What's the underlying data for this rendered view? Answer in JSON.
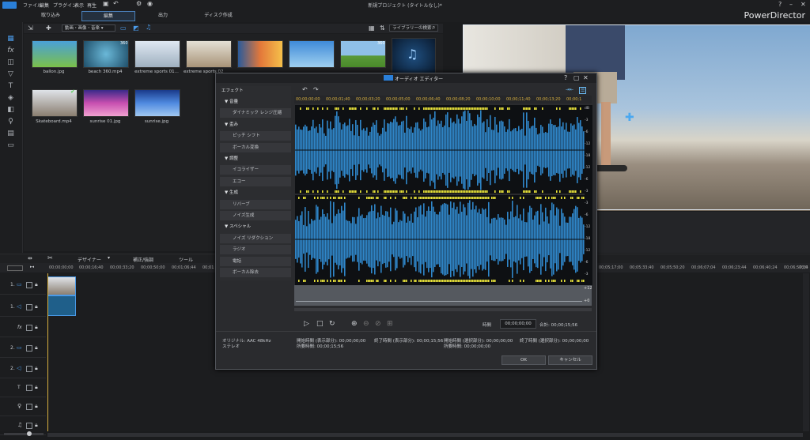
{
  "menu": [
    "ファイル",
    "編集",
    "プラグイン",
    "表示",
    "再生"
  ],
  "doc_title": "新規プロジェクト (タイトルなし)*",
  "brand": "PowerDirector",
  "modes": {
    "capture": "取り込み",
    "edit": "編集",
    "output": "出力",
    "disc": "ディスク作成"
  },
  "library": {
    "filter": "動画・画像・音楽",
    "search_placeholder": "ライブラリーの検索",
    "badge_360": "360",
    "items": [
      {
        "label": "ballon.jpg",
        "color": "#4aa0d8"
      },
      {
        "label": "beach 360.mp4",
        "color": "#3f8fb0"
      },
      {
        "label": "extreme sports 01...",
        "color": "#c9d4e0"
      },
      {
        "label": "extreme sports 02",
        "color": "#d7c9b3"
      },
      {
        "label": "",
        "color": "#e3783a"
      },
      {
        "label": "",
        "color": "#5b9ad8"
      },
      {
        "label": "",
        "color": "#6aa84a"
      },
      {
        "label": "",
        "color": "#0f2a4a"
      },
      {
        "label": "Skateboard.mp4",
        "color": "#9a8e80"
      },
      {
        "label": "sunrise 01.jpg",
        "color": "#8a4fb0"
      },
      {
        "label": "sunrise.jpg",
        "color": "#2f6fc0"
      }
    ]
  },
  "timeline": {
    "toolbar": {
      "designer": "デザイナー",
      "fix": "補正/強調",
      "tools": "ツール"
    },
    "ruler": [
      "00;00;00;00",
      "00;00;16;40",
      "00;00;33;20",
      "00;00;50;00",
      "00;01;06;44",
      "00;01;23;22",
      "00;05;17;00",
      "00;05;33;40",
      "00;05;50;20",
      "00;06;07;04",
      "00;06;23;44",
      "00;06;40;24",
      "00;06;57;04",
      "00;0"
    ],
    "tracks": [
      "1.",
      "1.",
      "fx",
      "2.",
      "2.",
      "T",
      "",
      ""
    ]
  },
  "dialog": {
    "title": "オーディオ エディター",
    "effects_header": "エフェクト",
    "effects": [
      {
        "t": "cat",
        "label": "音量"
      },
      {
        "t": "sub",
        "label": "ダイナミック レンジ圧縮"
      },
      {
        "t": "cat",
        "label": "歪み"
      },
      {
        "t": "sub",
        "label": "ピッチ シフト"
      },
      {
        "t": "sub",
        "label": "ボーカル変換"
      },
      {
        "t": "cat",
        "label": "調整"
      },
      {
        "t": "sub",
        "label": "イコライザー"
      },
      {
        "t": "sub",
        "label": "エコー"
      },
      {
        "t": "cat",
        "label": "生成"
      },
      {
        "t": "sub",
        "label": "リバーブ"
      },
      {
        "t": "sub",
        "label": "ノイズ生成"
      },
      {
        "t": "cat",
        "label": "スペシャル"
      },
      {
        "t": "sub",
        "label": "ノイズ リダクション"
      },
      {
        "t": "sub",
        "label": "ラジオ"
      },
      {
        "t": "sub",
        "label": "電話"
      },
      {
        "t": "sub",
        "label": "ボーカル除去"
      }
    ],
    "ruler": [
      "00;00;00;00",
      "00;00;01;40",
      "00;00;03;20",
      "00;00;05;00",
      "00;00;06;40",
      "00;00;08;20",
      "00;00;10;00",
      "00;00;11;40",
      "00;00;13;20",
      "00;00;1"
    ],
    "db_labels": [
      "dB",
      "-3",
      "-6",
      "-12",
      "-18",
      "-12",
      "-6",
      "-3",
      "-3",
      "-6",
      "-12",
      "-18",
      "-12",
      "-6",
      "-3"
    ],
    "env_labels": [
      "+12",
      "+0"
    ],
    "time_label": "時間",
    "time_value": "00;00;00;00",
    "total": "合計: 00;00;15;56",
    "original": "オリジナル: AAC 48kHz",
    "channel": "ステレオ",
    "start_disp": "開始時間 (表示部分): 00;00;00;00",
    "end_disp": "終了時間 (表示部分): 00;00;15;56",
    "dur_disp": "所要時間: 00;00;15;56",
    "start_sel": "開始時間 (選択部分): 00;00;00;00",
    "end_sel": "終了時間 (選択部分): 00;00;00;00",
    "dur_sel": "所要時間: 00;00;00;00",
    "ok": "OK",
    "cancel": "キャンセル"
  },
  "colors": {
    "accent": "#2a7fd8",
    "wave": "#2f86c8",
    "wave_peak": "#e8e23a"
  }
}
